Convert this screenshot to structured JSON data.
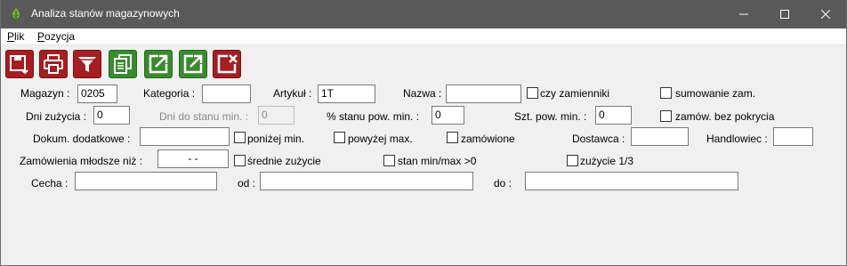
{
  "window": {
    "title": "Analiza stanów magazynowych"
  },
  "menu": {
    "plik": {
      "accel": "P",
      "rest": "lik"
    },
    "pozycja": {
      "accel": "P",
      "rest": "ozycja"
    }
  },
  "toolbar": [
    {
      "name": "save-export-icon",
      "color": "#a51e22"
    },
    {
      "name": "print-icon",
      "color": "#a51e22"
    },
    {
      "name": "filter-icon",
      "color": "#a51e22"
    },
    {
      "name": "copy-icon",
      "color": "#3a8a2f"
    },
    {
      "name": "open-external-icon",
      "color": "#3a8a2f"
    },
    {
      "name": "open-external-icon",
      "color": "#3a8a2f"
    },
    {
      "name": "close-document-icon",
      "color": "#a51e22"
    }
  ],
  "form": {
    "magazyn": {
      "label": "Magazyn :",
      "value": "0205"
    },
    "kategoria": {
      "label": "Kategoria :",
      "value": ""
    },
    "artykul": {
      "label": "Artykuł :",
      "value": "1T"
    },
    "nazwa": {
      "label": "Nazwa :",
      "value": ""
    },
    "czy_zamienniki": {
      "label": "czy zamienniki"
    },
    "sumowanie_zam": {
      "label": "sumowanie zam."
    },
    "dni_zuzycia": {
      "label": "Dni zużycia :",
      "value": "0"
    },
    "dni_do_stanu": {
      "label": "Dni do stanu min. :",
      "value": "0"
    },
    "proc_stanu": {
      "label": "% stanu pow. min. :",
      "value": "0"
    },
    "szt_pow": {
      "label": "Szt. pow. min. :",
      "value": "0"
    },
    "zamow_bez": {
      "label": "zamów. bez pokrycia"
    },
    "dokum": {
      "label": "Dokum. dodatkowe :",
      "value": ""
    },
    "ponizej": {
      "label": "poniżej min."
    },
    "powyzej": {
      "label": "powyżej max."
    },
    "zamowione": {
      "label": "zamówione"
    },
    "dostawca": {
      "label": "Dostawca :",
      "value": ""
    },
    "handlowiec": {
      "label": "Handlowiec :",
      "value": ""
    },
    "zamowienia": {
      "label": "Zamówienia młodsze niż :",
      "value": "  -  -"
    },
    "srednie": {
      "label": "średnie zużycie"
    },
    "stan_minmax": {
      "label": "stan min/max >0"
    },
    "zuzycie13": {
      "label": "zużycie 1/3"
    },
    "cecha": {
      "label": "Cecha :",
      "value": ""
    },
    "od": {
      "label": "od :",
      "value": ""
    },
    "do": {
      "label": "do :",
      "value": ""
    }
  }
}
